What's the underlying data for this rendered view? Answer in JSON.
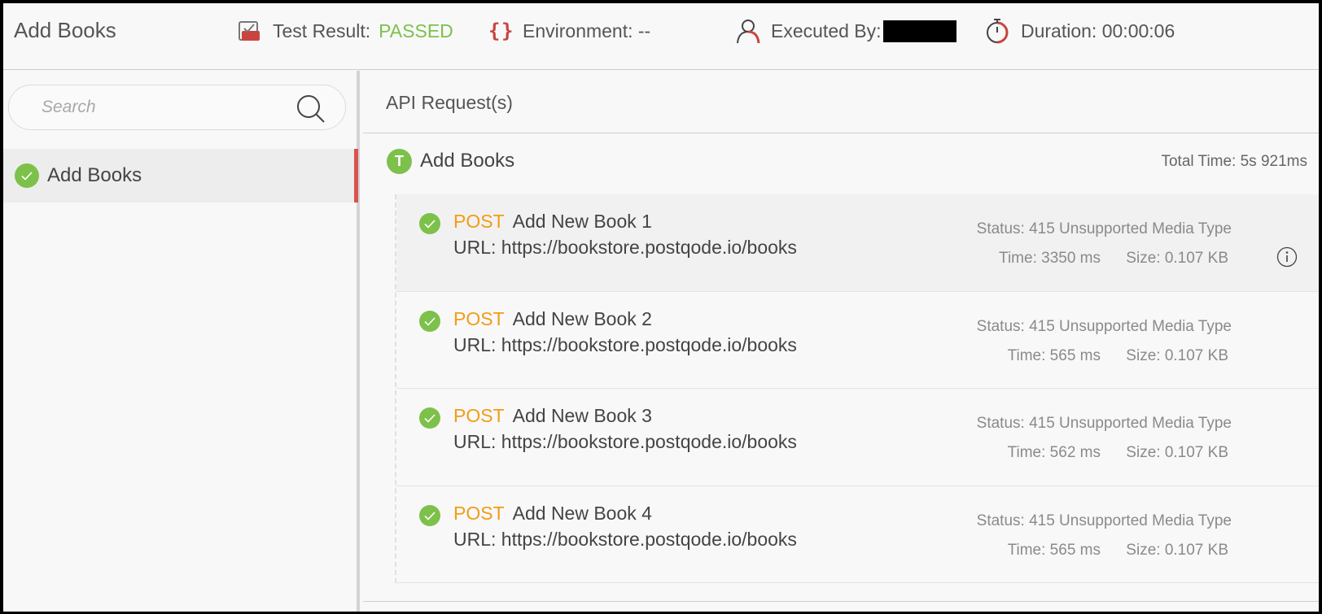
{
  "header": {
    "title": "Add Books",
    "test_result_label": "Test Result:",
    "test_result_value": "PASSED",
    "environment_label": "Environment: --",
    "executed_by_label": "Executed By:",
    "duration_label": "Duration: 00:00:06"
  },
  "sidebar": {
    "search_placeholder": "Search",
    "items": [
      {
        "label": "Add Books",
        "status": "passed"
      }
    ]
  },
  "main": {
    "section_title": "API Request(s)",
    "group": {
      "badge": "T",
      "name": "Add Books",
      "total_time": "Total Time: 5s 921ms"
    },
    "requests": [
      {
        "method": "POST",
        "name": "Add New Book 1",
        "url": "URL: https://bookstore.postqode.io/books",
        "status": "Status: 415 Unsupported Media Type",
        "time": "Time: 3350 ms",
        "size": "Size: 0.107 KB"
      },
      {
        "method": "POST",
        "name": "Add New Book 2",
        "url": "URL: https://bookstore.postqode.io/books",
        "status": "Status: 415 Unsupported Media Type",
        "time": "Time: 565 ms",
        "size": "Size: 0.107 KB"
      },
      {
        "method": "POST",
        "name": "Add New Book 3",
        "url": "URL: https://bookstore.postqode.io/books",
        "status": "Status: 415 Unsupported Media Type",
        "time": "Time: 562 ms",
        "size": "Size: 0.107 KB"
      },
      {
        "method": "POST",
        "name": "Add New Book 4",
        "url": "URL: https://bookstore.postqode.io/books",
        "status": "Status: 415 Unsupported Media Type",
        "time": "Time: 565 ms",
        "size": "Size: 0.107 KB"
      }
    ]
  },
  "colors": {
    "passed": "#7dc14b",
    "method": "#f39c12",
    "accent_red": "#d9534f"
  },
  "icons": {
    "test_result": "checkbox-icon",
    "environment": "curly-braces-icon",
    "executed_by": "user-icon",
    "duration": "stopwatch-icon",
    "search": "search-icon",
    "status": "check-circle-icon",
    "info": "info-icon"
  }
}
